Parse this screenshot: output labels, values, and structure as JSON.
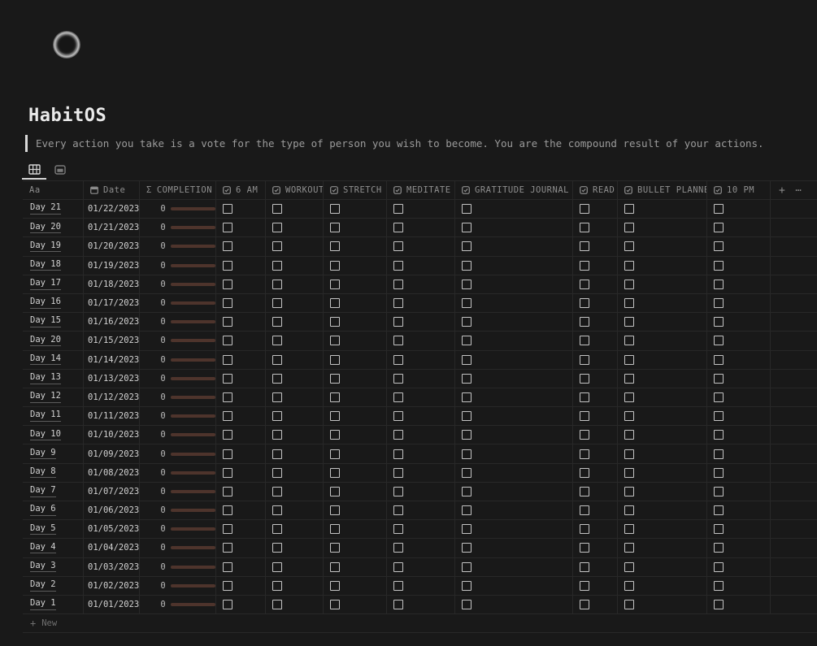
{
  "page": {
    "icon": "new-moon",
    "title": "HabitOS",
    "quote": "Every action you take is a vote for the type of person you wish to become. You are the compound result of your actions."
  },
  "views": {
    "tabs": [
      {
        "name": "table",
        "icon": "table-view-icon",
        "active": true
      },
      {
        "name": "gallery",
        "icon": "gallery-view-icon",
        "active": false
      }
    ]
  },
  "table": {
    "columns": [
      {
        "id": "name",
        "icon": null,
        "label": "Aa"
      },
      {
        "id": "date",
        "icon": "calendar-icon",
        "label": "Date"
      },
      {
        "id": "completion",
        "icon": "sigma-icon",
        "label": "COMPLETION"
      },
      {
        "id": "6am",
        "icon": "checkbox-icon",
        "label": "6 AM"
      },
      {
        "id": "workout",
        "icon": "checkbox-icon",
        "label": "WORKOUT"
      },
      {
        "id": "stretch",
        "icon": "checkbox-icon",
        "label": "STRETCH"
      },
      {
        "id": "meditate",
        "icon": "checkbox-icon",
        "label": "MEDITATE"
      },
      {
        "id": "gratitude-journal",
        "icon": "checkbox-icon",
        "label": "GRATITUDE JOURNAL"
      },
      {
        "id": "read",
        "icon": "checkbox-icon",
        "label": "READ"
      },
      {
        "id": "bullet-planner",
        "icon": "checkbox-icon",
        "label": "BULLET PLANNER"
      },
      {
        "id": "10pm",
        "icon": "checkbox-icon",
        "label": "10 PM"
      }
    ],
    "add_column_label": "+",
    "more_options_label": "⋯",
    "rows": [
      {
        "name": "Day 21",
        "date": "01/22/2023",
        "completion": 0,
        "habits": [
          false,
          false,
          false,
          false,
          false,
          false,
          false,
          false
        ]
      },
      {
        "name": "Day 20",
        "date": "01/21/2023",
        "completion": 0,
        "habits": [
          false,
          false,
          false,
          false,
          false,
          false,
          false,
          false
        ]
      },
      {
        "name": "Day 19",
        "date": "01/20/2023",
        "completion": 0,
        "habits": [
          false,
          false,
          false,
          false,
          false,
          false,
          false,
          false
        ]
      },
      {
        "name": "Day 18",
        "date": "01/19/2023",
        "completion": 0,
        "habits": [
          false,
          false,
          false,
          false,
          false,
          false,
          false,
          false
        ]
      },
      {
        "name": "Day 17",
        "date": "01/18/2023",
        "completion": 0,
        "habits": [
          false,
          false,
          false,
          false,
          false,
          false,
          false,
          false
        ]
      },
      {
        "name": "Day 16",
        "date": "01/17/2023",
        "completion": 0,
        "habits": [
          false,
          false,
          false,
          false,
          false,
          false,
          false,
          false
        ]
      },
      {
        "name": "Day 15",
        "date": "01/16/2023",
        "completion": 0,
        "habits": [
          false,
          false,
          false,
          false,
          false,
          false,
          false,
          false
        ]
      },
      {
        "name": "Day 20",
        "date": "01/15/2023",
        "completion": 0,
        "habits": [
          false,
          false,
          false,
          false,
          false,
          false,
          false,
          false
        ]
      },
      {
        "name": "Day 14",
        "date": "01/14/2023",
        "completion": 0,
        "habits": [
          false,
          false,
          false,
          false,
          false,
          false,
          false,
          false
        ]
      },
      {
        "name": "Day 13",
        "date": "01/13/2023",
        "completion": 0,
        "habits": [
          false,
          false,
          false,
          false,
          false,
          false,
          false,
          false
        ]
      },
      {
        "name": "Day 12",
        "date": "01/12/2023",
        "completion": 0,
        "habits": [
          false,
          false,
          false,
          false,
          false,
          false,
          false,
          false
        ]
      },
      {
        "name": "Day 11",
        "date": "01/11/2023",
        "completion": 0,
        "habits": [
          false,
          false,
          false,
          false,
          false,
          false,
          false,
          false
        ]
      },
      {
        "name": "Day 10",
        "date": "01/10/2023",
        "completion": 0,
        "habits": [
          false,
          false,
          false,
          false,
          false,
          false,
          false,
          false
        ]
      },
      {
        "name": "Day 9",
        "date": "01/09/2023",
        "completion": 0,
        "habits": [
          false,
          false,
          false,
          false,
          false,
          false,
          false,
          false
        ]
      },
      {
        "name": "Day 8",
        "date": "01/08/2023",
        "completion": 0,
        "habits": [
          false,
          false,
          false,
          false,
          false,
          false,
          false,
          false
        ]
      },
      {
        "name": "Day 7",
        "date": "01/07/2023",
        "completion": 0,
        "habits": [
          false,
          false,
          false,
          false,
          false,
          false,
          false,
          false
        ]
      },
      {
        "name": "Day 6",
        "date": "01/06/2023",
        "completion": 0,
        "habits": [
          false,
          false,
          false,
          false,
          false,
          false,
          false,
          false
        ]
      },
      {
        "name": "Day 5",
        "date": "01/05/2023",
        "completion": 0,
        "habits": [
          false,
          false,
          false,
          false,
          false,
          false,
          false,
          false
        ]
      },
      {
        "name": "Day 4",
        "date": "01/04/2023",
        "completion": 0,
        "habits": [
          false,
          false,
          false,
          false,
          false,
          false,
          false,
          false
        ]
      },
      {
        "name": "Day 3",
        "date": "01/03/2023",
        "completion": 0,
        "habits": [
          false,
          false,
          false,
          false,
          false,
          false,
          false,
          false
        ]
      },
      {
        "name": "Day 2",
        "date": "01/02/2023",
        "completion": 0,
        "habits": [
          false,
          false,
          false,
          false,
          false,
          false,
          false,
          false
        ]
      },
      {
        "name": "Day 1",
        "date": "01/01/2023",
        "completion": 0,
        "habits": [
          false,
          false,
          false,
          false,
          false,
          false,
          false,
          false
        ]
      }
    ],
    "new_row": {
      "icon": "+",
      "label": "New"
    }
  },
  "colors": {
    "background": "#191919",
    "grid_line": "#282828",
    "progress_bar": "#4e342c",
    "active_tab_underline": "#d6d6d6",
    "checkbox_border": "#c4c4c4"
  }
}
